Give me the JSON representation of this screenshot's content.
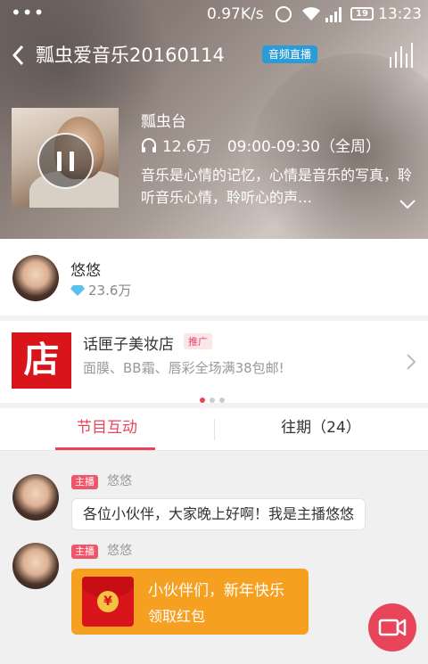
{
  "status_bar": {
    "dots": "•••",
    "network_speed": "0.97K/s",
    "battery": "19",
    "time": "13:23"
  },
  "header": {
    "back_icon": "back-arrow-icon",
    "title": "瓢虫爱音乐20160114",
    "badge": "音频直播",
    "equalizer_icon": "equalizer-icon"
  },
  "program": {
    "station": "瓢虫台",
    "listeners": "12.6万",
    "schedule": "09:00-09:30（全周）",
    "description": "音乐是心情的记忆，心情是音乐的写真，聆听音乐心情，聆听心的声…",
    "player_state": "paused"
  },
  "host": {
    "name": "悠悠",
    "fans": "23.6万"
  },
  "ad": {
    "logo_char": "店",
    "title": "话匣子美妆店",
    "tag": "推广",
    "description": "面膜、BB霜、唇彩全场满38包邮!",
    "carousel_active_index": 0,
    "carousel_count": 3
  },
  "tabs": [
    {
      "label": "节目互动",
      "active": true
    },
    {
      "label": "往期（24）",
      "active": false
    }
  ],
  "messages": [
    {
      "role": "主播",
      "sender": "悠悠",
      "text": "各位小伙伴，大家晚上好啊！我是主播悠悠"
    },
    {
      "role": "主播",
      "sender": "悠悠",
      "red_packet_text": "小伙伴们，新年快乐",
      "red_packet_action": "领取红包",
      "coin_symbol": "¥"
    }
  ],
  "colors": {
    "accent": "#e8445a",
    "live_badge": "#2b9cd8",
    "red_packet": "#f5a021",
    "ad_logo": "#d9141b"
  }
}
